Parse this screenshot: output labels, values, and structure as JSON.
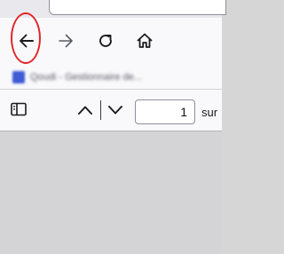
{
  "tab": {
    "title": ""
  },
  "nav": {
    "back_icon": "arrow-left-icon",
    "forward_icon": "arrow-right-icon",
    "reload_icon": "reload-icon",
    "home_icon": "home-icon",
    "highlight_color": "#e0262b"
  },
  "bookmarks": {
    "items": [
      {
        "label": "Qoudi - Gestionnaire de...",
        "icon": "favicon",
        "color": "#3f5bd6"
      }
    ]
  },
  "pdf_toolbar": {
    "sidebar_icon": "sidebar-toggle-icon",
    "prev_icon": "chevron-up-icon",
    "next_icon": "chevron-down-icon",
    "page_number": "1",
    "of_label": "sur"
  }
}
